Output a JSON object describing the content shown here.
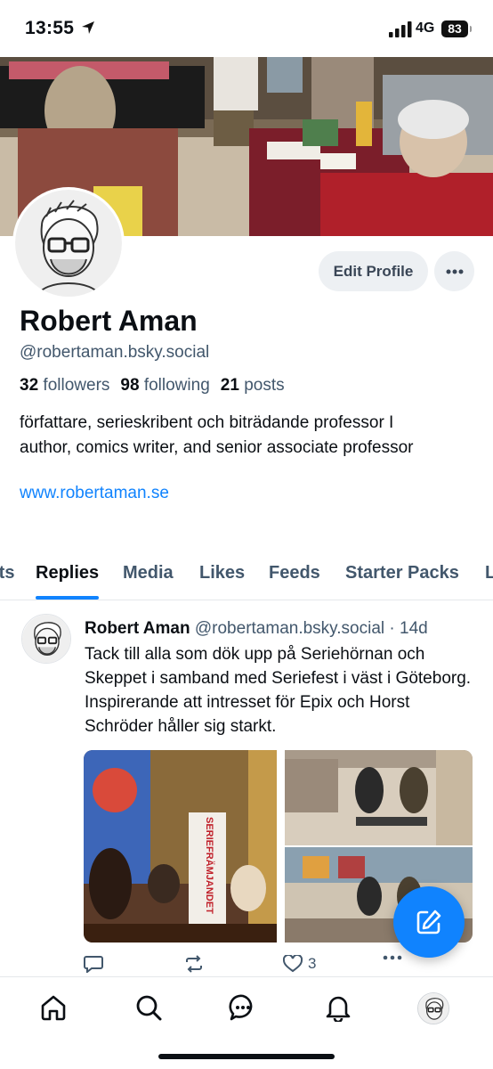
{
  "status_bar": {
    "time": "13:55",
    "network": "4G",
    "battery": "83"
  },
  "profile": {
    "display_name": "Robert Aman",
    "handle": "@robertaman.bsky.social",
    "edit_label": "Edit Profile",
    "followers_count": "32",
    "followers_label": "followers",
    "following_count": "98",
    "following_label": "following",
    "posts_count": "21",
    "posts_label": "posts",
    "bio_line1": "författare, serieskribent och biträdande professor I",
    "bio_line2": "author, comics writer, and senior associate professor",
    "website": "www.robertaman.se"
  },
  "tabs": [
    {
      "label": "Posts"
    },
    {
      "label": "Replies"
    },
    {
      "label": "Media"
    },
    {
      "label": "Likes"
    },
    {
      "label": "Feeds"
    },
    {
      "label": "Starter Packs"
    },
    {
      "label": "Lists"
    }
  ],
  "active_tab": "Replies",
  "post": {
    "author": "Robert Aman",
    "handle": "@robertaman.bsky.social",
    "age": "· 14d",
    "text": "Tack till alla som dök upp på Seriehörnan och Skeppet i samband med Seriefest i väst i Göteborg. Inspirerande att intresset för Epix och Horst Schröder håller sig starkt.",
    "likes": "3",
    "banner_text": "SERIEFRÄMJANDET"
  },
  "colors": {
    "accent": "#1083fe",
    "muted": "#42576c",
    "text": "#0b0f14"
  },
  "icons": [
    "location-arrow-icon",
    "signal-icon",
    "ellipsis-icon",
    "reply-icon",
    "repost-icon",
    "heart-icon",
    "compose-icon",
    "home-icon",
    "search-icon",
    "chat-icon",
    "bell-icon"
  ]
}
